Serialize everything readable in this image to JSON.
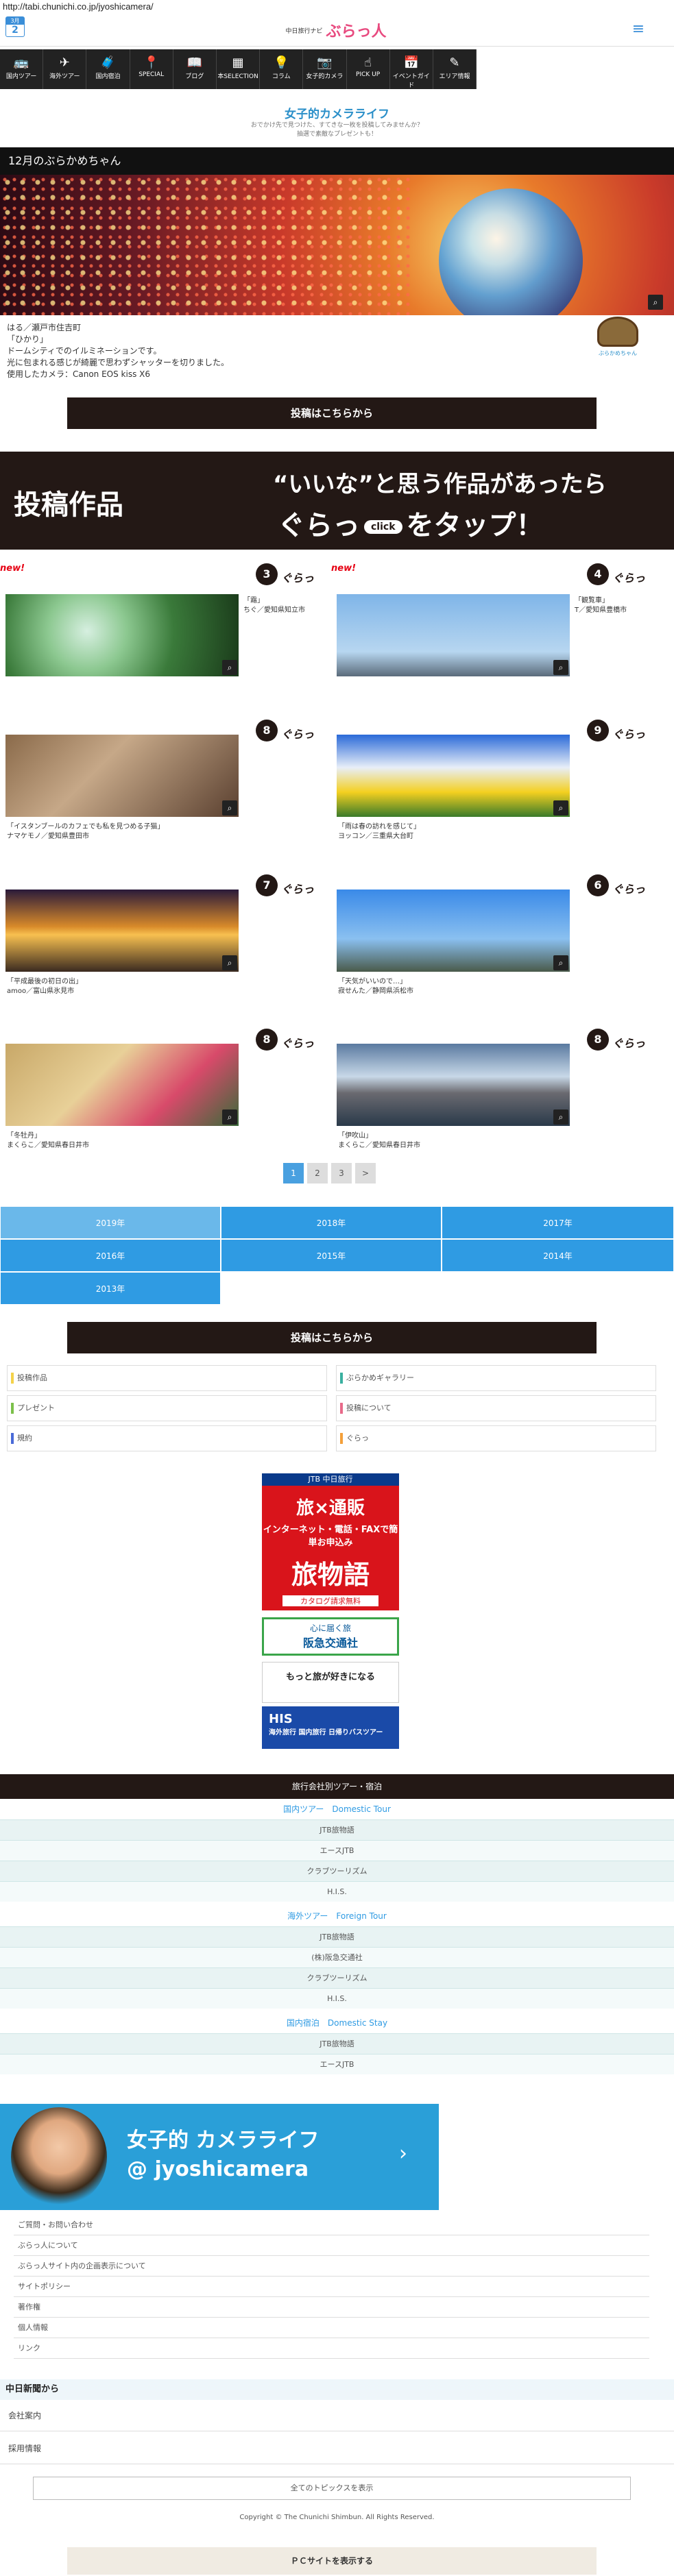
{
  "url": "http://tabi.chunichi.co.jp/jyoshicamera/",
  "header": {
    "cal_month": "3月",
    "cal_day": "2",
    "logo_small": "中日旅行ナビ",
    "logo_big": "ぶらっ人"
  },
  "nav": [
    {
      "label": "国内ツアー",
      "icon": "bus-icon",
      "glyph": "🚌"
    },
    {
      "label": "海外ツアー",
      "icon": "plane-icon",
      "glyph": "✈"
    },
    {
      "label": "国内宿泊",
      "icon": "suitcase-icon",
      "glyph": "🧳"
    },
    {
      "label": "SPECIAL",
      "icon": "pin-icon",
      "glyph": "📍"
    },
    {
      "label": "ブログ",
      "icon": "book-icon",
      "glyph": "📖"
    },
    {
      "label": "本SELECTION",
      "icon": "grid-icon",
      "glyph": "▦"
    },
    {
      "label": "コラム",
      "icon": "bulb-icon",
      "glyph": "💡"
    },
    {
      "label": "女子的カメラ",
      "icon": "camera-icon",
      "glyph": "📷"
    },
    {
      "label": "PICK UP",
      "icon": "hand-icon",
      "glyph": "☝"
    },
    {
      "label": "イベントガイド",
      "icon": "calendar-icon",
      "glyph": "📅"
    },
    {
      "label": "エリア情報",
      "icon": "brush-icon",
      "glyph": "✎"
    }
  ],
  "intro": {
    "title": "女子的カメラライフ",
    "line1": "おでかけ先で見つけた、すてきな一枚を投稿してみませんか？",
    "line2": "抽選で素敵なプレゼントも！"
  },
  "month_title": "12月のぶらかめちゃん",
  "hero_caption": [
    "はる／瀬戸市住吉町",
    "「ひかり」",
    "ドームシティでのイルミネーションです。",
    "光に包まれる感じが綺麗で思わずシャッターを切りました。",
    "使用したカメラ：Canon EOS kiss X6"
  ],
  "turtle_label": "ぶらかめちゃん",
  "post_button": "投稿はこちらから",
  "banner": {
    "left": "投稿作品",
    "right1": "“いいな”と思う作品があったら",
    "gura": "ぐらっ",
    "click": "click",
    "right2": "をタップ！"
  },
  "works": [
    {
      "count": "3",
      "new": "new!",
      "title": "「霜」",
      "author": "ちぐ／愛知県知立市"
    },
    {
      "count": "4",
      "new": "new!",
      "title": "「観覧車」",
      "author": "T／愛知県豊橋市"
    },
    {
      "count": "8",
      "new": "",
      "title": "「イスタンブールのカフェでも私を見つめる子猫」",
      "author": "ナマケモノ／愛知県豊田市"
    },
    {
      "count": "9",
      "new": "",
      "title": "「雨は春の訪れを感じて」",
      "author": "ヨッコン／三重県大台町"
    },
    {
      "count": "7",
      "new": "",
      "title": "「平成最後の初日の出」",
      "author": "amoo／富山県氷見市"
    },
    {
      "count": "6",
      "new": "",
      "title": "「天気がいいので…」",
      "author": "寂せんた／静岡県浜松市"
    },
    {
      "count": "8",
      "new": "",
      "title": "「冬牡丹」",
      "author": "まくらこ／愛知県春日井市"
    },
    {
      "count": "8",
      "new": "",
      "title": "「伊吹山」",
      "author": "まくらこ／愛知県春日井市"
    }
  ],
  "gura_label": "ぐらっ",
  "pager": [
    "1",
    "2",
    "3",
    ">"
  ],
  "years": [
    "2019年",
    "2018年",
    "2017年",
    "2016年",
    "2015年",
    "2014年",
    "2013年"
  ],
  "links": [
    {
      "label": "投稿作品",
      "color": "#f4d24a"
    },
    {
      "label": "ぶらかめギャラリー",
      "color": "#3ab0a0"
    },
    {
      "label": "プレゼント",
      "color": "#7cc04a"
    },
    {
      "label": "投稿について",
      "color": "#e86a8a"
    },
    {
      "label": "規約",
      "color": "#4a6ad8"
    },
    {
      "label": "ぐらっ",
      "color": "#f4a03a"
    }
  ],
  "ads": {
    "jtb_top": "JTB 中日旅行",
    "jtb_b": "旅×通販",
    "jtb_c": "インターネット・電話・FAXで簡単お申込み",
    "jtb_d": "旅物語",
    "jtb_e": "カタログ請求無料",
    "hankyu_top": "心に届く旅",
    "hankyu_name": "阪急交通社",
    "club": "もっと旅が好きになる",
    "his_brand": "HIS",
    "his_sub": "海外旅行 国内旅行 日帰りバスツアー"
  },
  "tour": {
    "header": "旅行会社別ツアー・宿泊",
    "domestic": "国内ツアー　Domestic Tour",
    "domestic_items": [
      "JTB旅物語",
      "エースJTB",
      "クラブツーリズム",
      "H.I.S."
    ],
    "foreign": "海外ツアー　Foreign Tour",
    "foreign_items": [
      "JTB旅物語",
      "(株)阪急交通社",
      "クラブツーリズム",
      "H.I.S."
    ],
    "stay": "国内宿泊　Domestic Stay",
    "stay_items": [
      "JTB旅物語",
      "エースJTB"
    ]
  },
  "twitter": {
    "line1": "女子的  カメラライフ",
    "line2": "@ jyoshicamera"
  },
  "footer_links": [
    "ご質問・お問い合わせ",
    "ぶらっ人について",
    "ぶらっ人サイト内の企画表示について",
    "サイトポリシー",
    "著作権",
    "個人情報",
    "リンク"
  ],
  "chunichi": {
    "title": "中日新聞から",
    "items": [
      "会社案内",
      "採用情報"
    ]
  },
  "show_all": "全てのトピックスを表示",
  "copyright": "Copyright © The Chunichi Shimbun. All Rights Reserved.",
  "pc_button": "ＰＣサイトを表示する"
}
